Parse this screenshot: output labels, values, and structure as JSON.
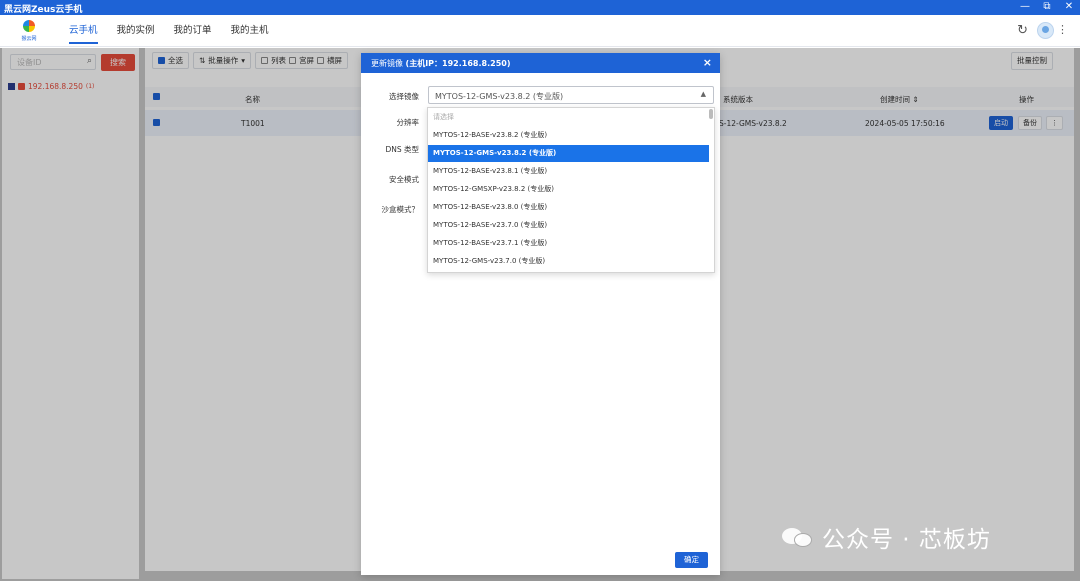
{
  "window": {
    "title": "黑云网Zeus云手机",
    "controls": [
      "—",
      "⧉",
      "✕"
    ]
  },
  "logo": {
    "text": "猴云网"
  },
  "nav": {
    "tabs": [
      "云手机",
      "我的实例",
      "我的订单",
      "我的主机"
    ],
    "active_index": 0
  },
  "sidebar": {
    "search_placeholder": "设备ID",
    "search_button": "搜索",
    "host": {
      "ip": "192.168.8.250",
      "count": "(1)"
    }
  },
  "toolbar": {
    "select_all": "全选",
    "batch_ops": "批量操作",
    "list": "列表",
    "grid": "宫屏",
    "split": "横屏",
    "batch_control": "批量控制"
  },
  "table": {
    "headers": {
      "name": "名称",
      "sys_version": "系统版本",
      "created_at": "创建时间",
      "actions": "操作"
    },
    "row": {
      "name": "T1001",
      "sys_version": "S-12-GMS-v23.8.2",
      "created_at": "2024-05-05 17:50:16",
      "start_btn": "启动",
      "backup_btn": "备份",
      "more_btn": "⋮"
    }
  },
  "modal": {
    "title_prefix": "更新镜像",
    "title_host": "(主机IP：192.168.8.250)",
    "close": "×",
    "labels": {
      "image": "选择镜像",
      "resolution": "分辨率",
      "dns": "DNS 类型",
      "security": "安全模式",
      "sandbox": "沙盒模式？"
    },
    "selected_value": "MYTOS-12-GMS-v23.8.2 (专业版)",
    "options": [
      {
        "label": "请选择",
        "placeholder": true,
        "selected": false
      },
      {
        "label": "MYTOS-12-BASE-v23.8.2 (专业版)",
        "placeholder": false,
        "selected": false
      },
      {
        "label": "MYTOS-12-GMS-v23.8.2 (专业版)",
        "placeholder": false,
        "selected": true
      },
      {
        "label": "MYTOS-12-BASE-v23.8.1 (专业版)",
        "placeholder": false,
        "selected": false
      },
      {
        "label": "MYTOS-12-GMSXP-v23.8.2 (专业版)",
        "placeholder": false,
        "selected": false
      },
      {
        "label": "MYTOS-12-BASE-v23.8.0 (专业版)",
        "placeholder": false,
        "selected": false
      },
      {
        "label": "MYTOS-12-BASE-v23.7.0 (专业版)",
        "placeholder": false,
        "selected": false
      },
      {
        "label": "MYTOS-12-BASE-v23.7.1 (专业版)",
        "placeholder": false,
        "selected": false
      },
      {
        "label": "MYTOS-12-GMS-v23.7.0 (专业版)",
        "placeholder": false,
        "selected": false
      }
    ],
    "ok_button": "确定"
  },
  "watermark": {
    "text": "公众号 · 芯板坊"
  },
  "colors": {
    "primary": "#1e63d6",
    "danger": "#e74c3c",
    "selected_option": "#1a73e8"
  }
}
